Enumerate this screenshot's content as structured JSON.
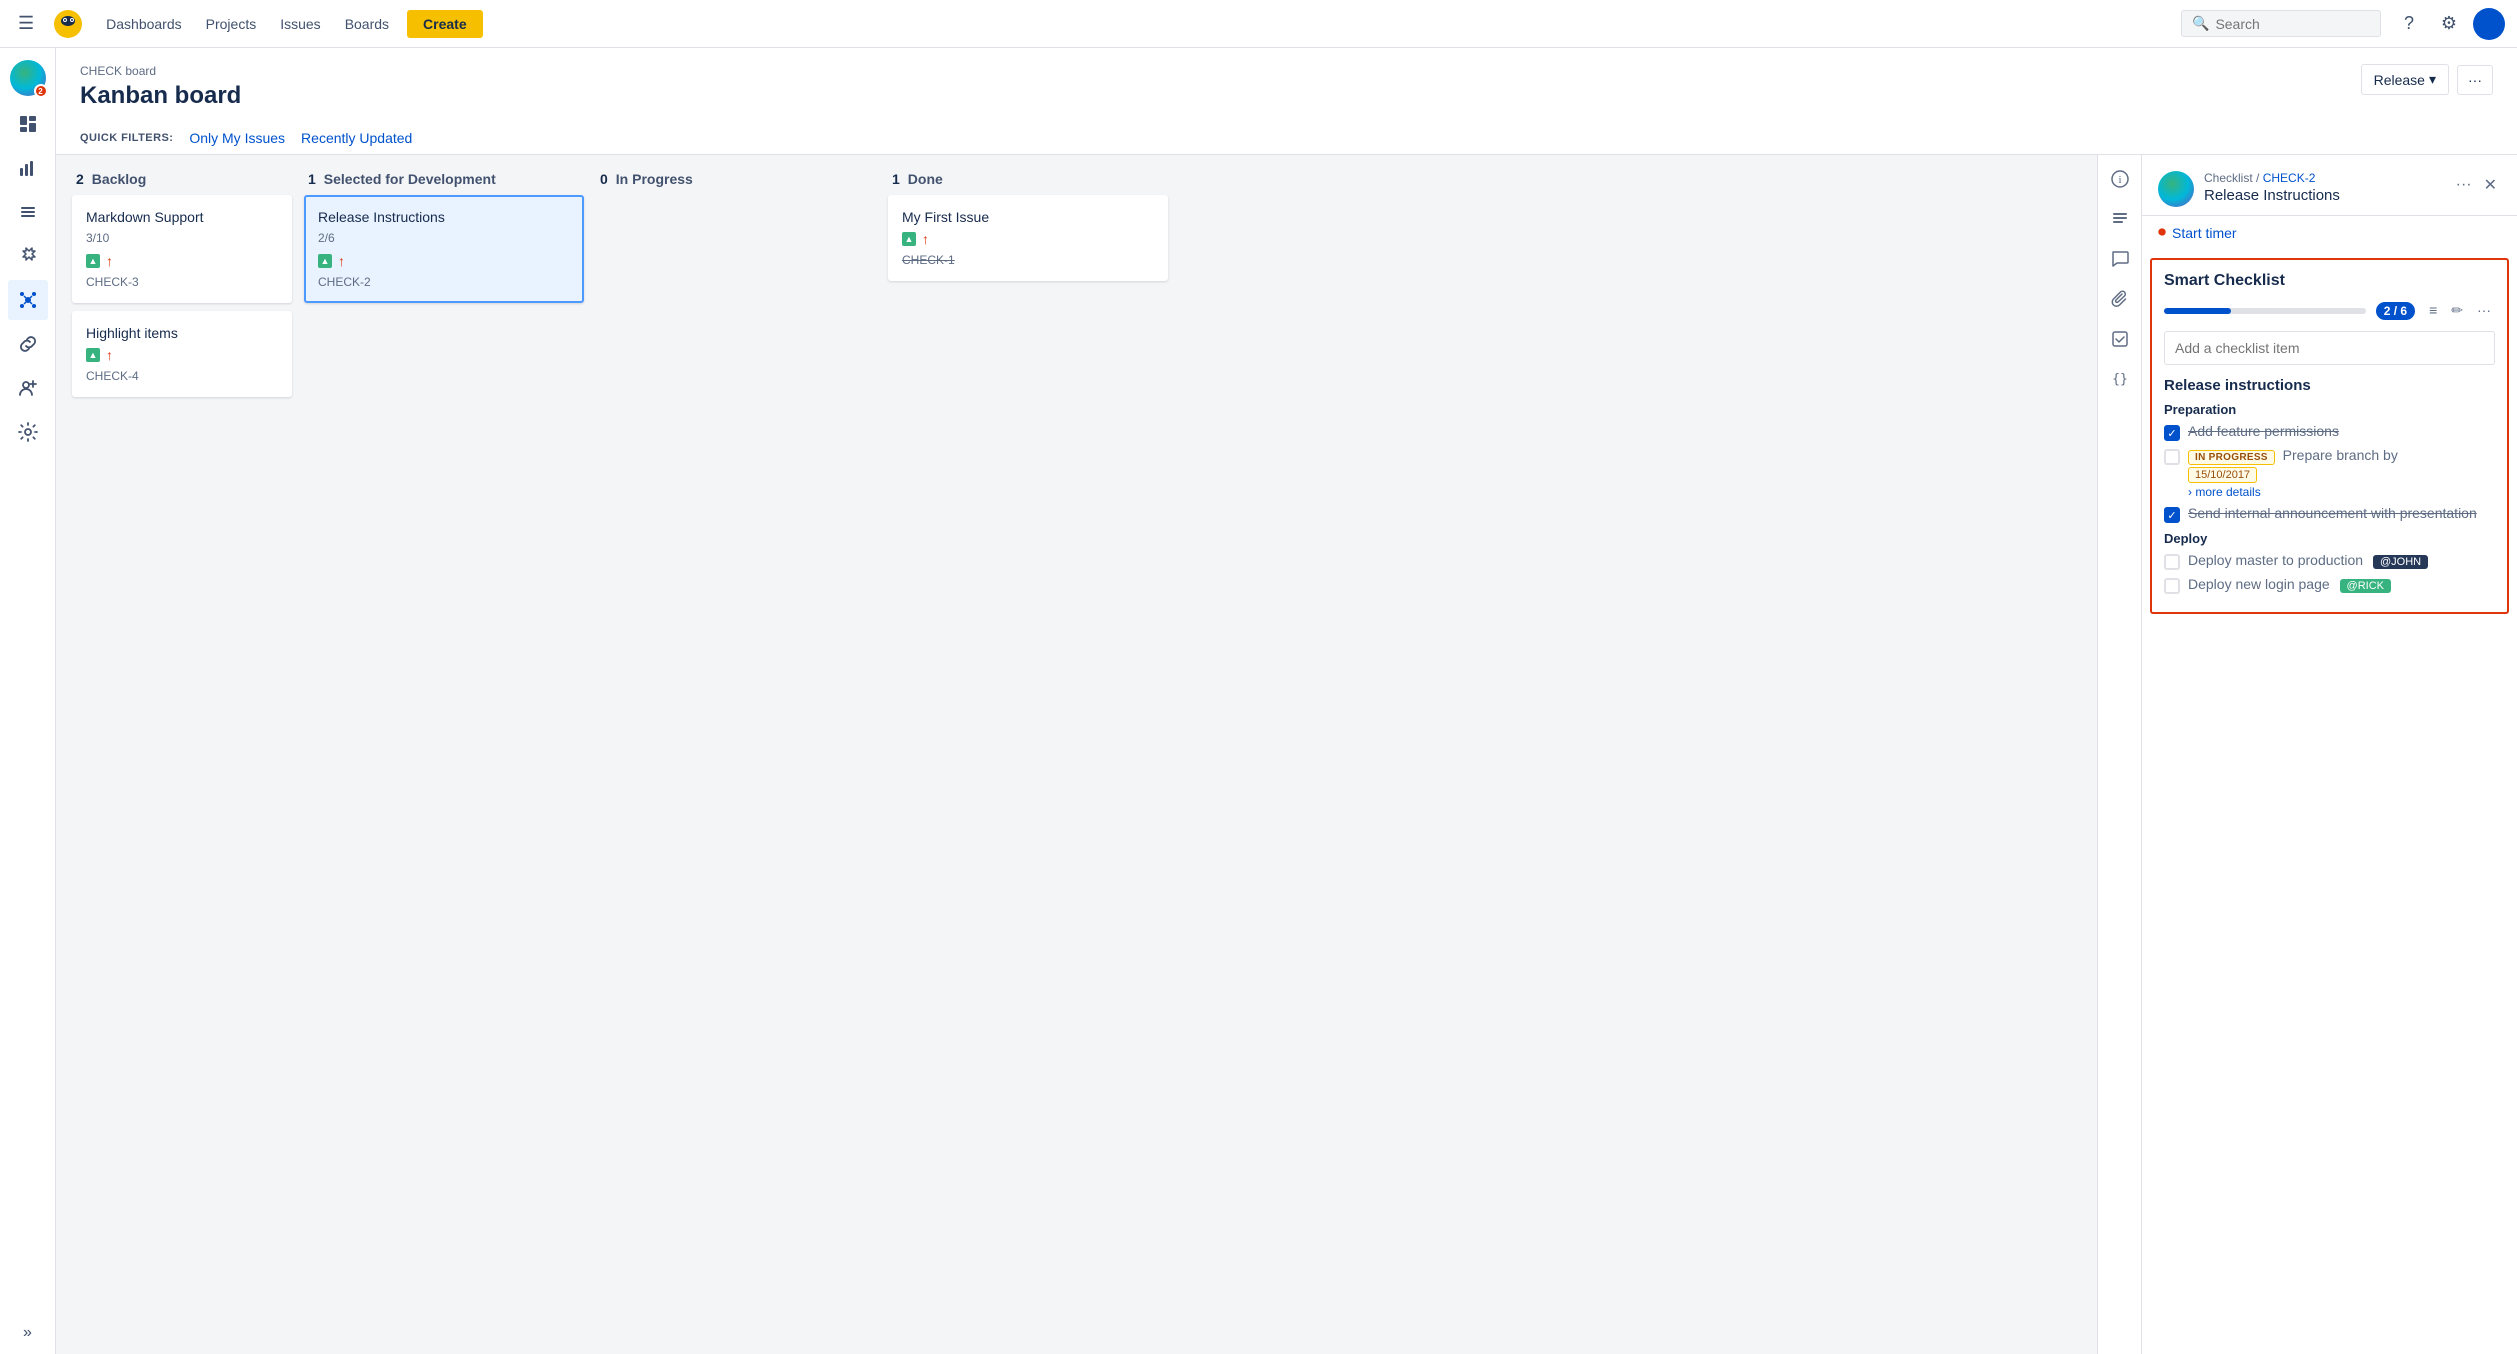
{
  "nav": {
    "hamburger": "☰",
    "dashboards": "Dashboards",
    "projects": "Projects",
    "issues": "Issues",
    "boards": "Boards",
    "create": "Create",
    "search_placeholder": "Search",
    "help_icon": "?",
    "settings_icon": "⚙"
  },
  "sidebar": {
    "items": [
      {
        "id": "home",
        "icon": "⊞",
        "label": "home"
      },
      {
        "id": "reports",
        "icon": "📊",
        "label": "reports"
      },
      {
        "id": "backlog",
        "icon": "≡",
        "label": "backlog"
      },
      {
        "id": "plugins",
        "icon": "🔧",
        "label": "plugins"
      },
      {
        "id": "nodes",
        "icon": "✳",
        "label": "nodes"
      },
      {
        "id": "links",
        "icon": "🔗",
        "label": "links"
      },
      {
        "id": "users",
        "icon": "👤+",
        "label": "users"
      },
      {
        "id": "settings",
        "icon": "⚙",
        "label": "settings"
      }
    ]
  },
  "board": {
    "breadcrumb": "CHECK board",
    "title": "Kanban board",
    "quick_filters_label": "QUICK FILTERS:",
    "filter_my_issues": "Only My Issues",
    "filter_recently_updated": "Recently Updated",
    "release_btn": "Release",
    "more_btn": "···",
    "columns": [
      {
        "id": "backlog",
        "count": "2",
        "name": "Backlog",
        "sub": "",
        "cards": [
          {
            "id": "card-markdown",
            "title": "Markdown Support",
            "meta": "3/10",
            "issue_id": "CHECK-3",
            "selected": false,
            "strikethrough": false
          },
          {
            "id": "card-highlight",
            "title": "Highlight items",
            "meta": "",
            "issue_id": "CHECK-4",
            "selected": false,
            "strikethrough": false
          }
        ]
      },
      {
        "id": "selected",
        "count": "1",
        "name": "Selected for Development",
        "sub": "",
        "cards": [
          {
            "id": "card-release",
            "title": "Release Instructions",
            "meta": "2/6",
            "issue_id": "CHECK-2",
            "selected": true,
            "strikethrough": false
          }
        ]
      },
      {
        "id": "in-progress",
        "count": "0",
        "name": "In Progress",
        "sub": "",
        "cards": []
      },
      {
        "id": "done",
        "count": "1",
        "name": "Done",
        "sub": "",
        "cards": [
          {
            "id": "card-first",
            "title": "My First Issue",
            "meta": "",
            "issue_id": "CHECK-1",
            "selected": false,
            "strikethrough": true
          }
        ]
      }
    ]
  },
  "detail": {
    "breadcrumb_parent": "Checklist",
    "breadcrumb_issue": "CHECK-2",
    "issue_title": "Release Instructions",
    "timer_label": "Start timer",
    "checklist": {
      "title": "Smart Checklist",
      "progress_text": "2 / 6",
      "add_placeholder": "Add a checklist item",
      "section_title": "Release instructions",
      "subsection_preparation": "Preparation",
      "subsection_deploy": "Deploy",
      "items": [
        {
          "id": "item1",
          "text": "Add feature permissions",
          "checked": true,
          "strikethrough": true,
          "status": null,
          "date": null,
          "more_details": false,
          "assignee": null,
          "section": "preparation"
        },
        {
          "id": "item2",
          "text": "Prepare branch by",
          "checked": false,
          "strikethrough": false,
          "status": "IN PROGRESS",
          "date": "15/10/2017",
          "more_details": true,
          "more_details_label": "› more details",
          "assignee": null,
          "section": "preparation"
        },
        {
          "id": "item3",
          "text": "Send internal announcement with presentation",
          "checked": true,
          "strikethrough": true,
          "status": null,
          "date": null,
          "more_details": false,
          "assignee": null,
          "section": "preparation"
        },
        {
          "id": "item4",
          "text": "Deploy master to production",
          "checked": false,
          "strikethrough": false,
          "status": null,
          "date": null,
          "more_details": false,
          "assignee": "@JOHN",
          "assignee_color": "dark",
          "section": "deploy"
        },
        {
          "id": "item5",
          "text": "Deploy new login page",
          "checked": false,
          "strikethrough": false,
          "status": null,
          "date": null,
          "more_details": false,
          "assignee": "@RICK",
          "assignee_color": "green",
          "section": "deploy"
        }
      ]
    }
  }
}
